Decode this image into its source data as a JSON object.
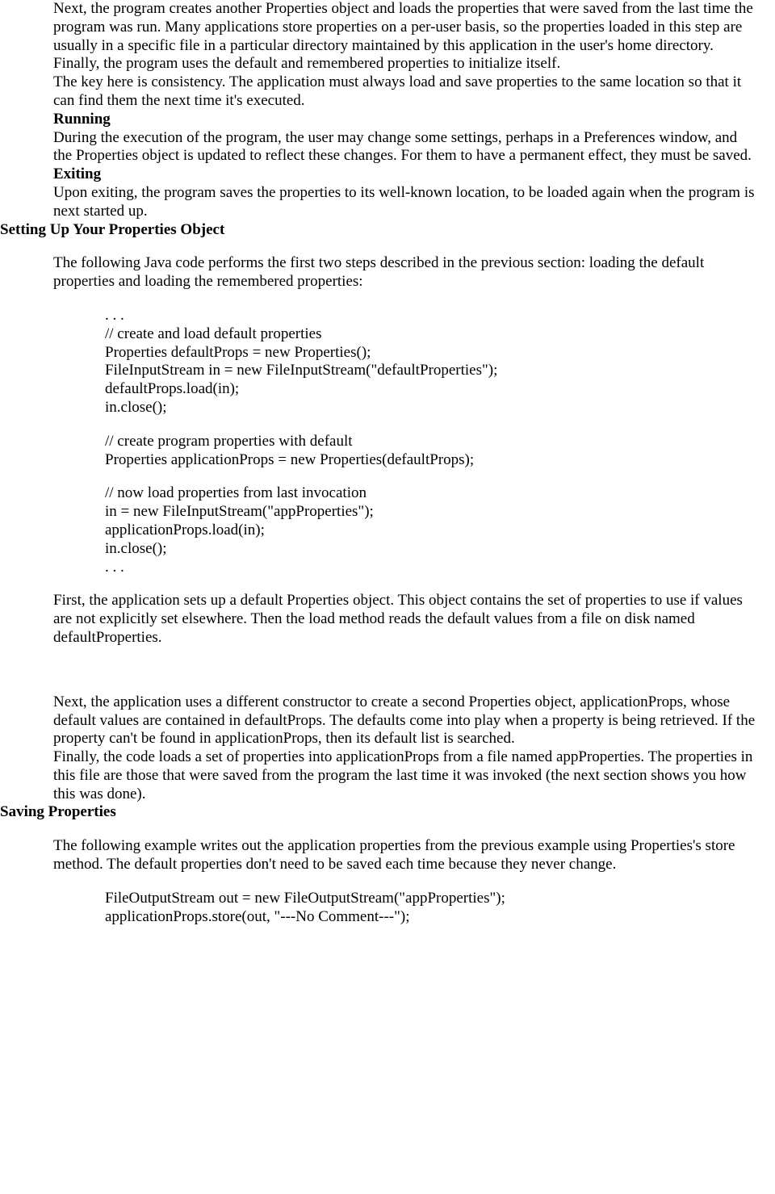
{
  "para1": "Next, the program creates another Properties object and loads the properties that were saved from the last time the program was run. Many applications store properties on a per-user basis, so the properties loaded in this step are usually in a specific file in a particular directory maintained by this application in the user's home directory. Finally, the program uses the default and remembered properties to initialize itself.",
  "para2": "The key here is consistency. The application must always load and save properties to the same location so that it can find them the next time it's executed.",
  "running_h": "Running",
  "running_p": "During the execution of the program, the user may change some settings, perhaps in a Preferences window, and the Properties object is updated to reflect these changes. For them to have a permanent effect, they must be saved.",
  "exiting_h": "Exiting",
  "exiting_p": "Upon exiting, the program saves the properties to its well-known location, to be loaded again when the program is next started up.",
  "setup_h": "Setting Up Your Properties Object",
  "setup_p": "The following Java code performs the first two steps described in the previous section: loading the default properties and loading the remembered properties:",
  "code": {
    "l1": ". . .",
    "l2": "// create and load default properties",
    "l3": "Properties defaultProps = new Properties();",
    "l4": "FileInputStream in = new FileInputStream(\"defaultProperties\");",
    "l5": "defaultProps.load(in);",
    "l6": "in.close();",
    "l7": "// create program properties with default",
    "l8": "Properties applicationProps = new Properties(defaultProps);",
    "l9": "// now load properties from last invocation",
    "l10": "in = new FileInputStream(\"appProperties\");",
    "l11": "applicationProps.load(in);",
    "l12": "in.close();",
    "l13": ". . ."
  },
  "after1": "First, the application sets up a default Properties object. This object contains the set of properties to use if values are not explicitly set elsewhere. Then the load method reads the default values from a file on disk named defaultProperties.",
  "after2": "Next, the application uses a different constructor to create a second Properties object, applicationProps, whose default values are contained in defaultProps. The defaults come into play when a property is being retrieved. If the property can't be found in applicationProps, then its default list is searched.",
  "after3": "Finally, the code loads a set of properties into applicationProps from a file named appProperties. The properties in this file are those that were saved from the program the last time it was invoked (the next section shows you how this was done).",
  "saving_h": "Saving Properties",
  "saving_p": "The following example writes out the application properties from the previous example using Properties's store method. The default properties don't need to be saved each time because they never change.",
  "code2": {
    "l1": "FileOutputStream out = new FileOutputStream(\"appProperties\");",
    "l2": "applicationProps.store(out, \"---No Comment---\");"
  }
}
